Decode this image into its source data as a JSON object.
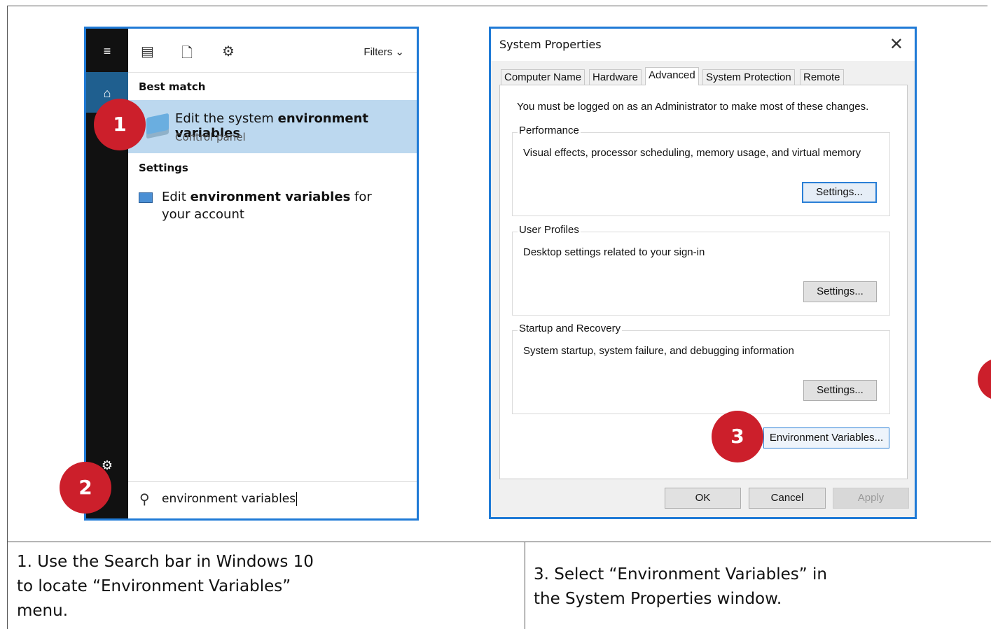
{
  "start_menu": {
    "filters_label": "Filters",
    "best_match_label": "Best match",
    "best_match": {
      "title_prefix": "Edit the system ",
      "title_bold": "environment variables",
      "subtitle": "Control panel"
    },
    "settings_label": "Settings",
    "settings_item": {
      "prefix": "Edit ",
      "bold": "environment variables",
      "suffix": " for your account"
    },
    "search_query": "environment variables"
  },
  "badges": {
    "one": "1",
    "two": "2",
    "three": "3"
  },
  "dialog": {
    "title": "System Properties",
    "tabs": [
      "Computer Name",
      "Hardware",
      "Advanced",
      "System Protection",
      "Remote"
    ],
    "active_tab": "Advanced",
    "note": "You must be logged on as an Administrator to make most of these changes.",
    "groups": [
      {
        "label": "Performance",
        "desc": "Visual effects, processor scheduling, memory usage, and virtual memory",
        "button": "Settings..."
      },
      {
        "label": "User Profiles",
        "desc": "Desktop settings related to your sign-in",
        "button": "Settings..."
      },
      {
        "label": "Startup and Recovery",
        "desc": "System startup, system failure, and debugging information",
        "button": "Settings..."
      }
    ],
    "env_button": "Environment Variables...",
    "ok": "OK",
    "cancel": "Cancel",
    "apply": "Apply"
  },
  "captions": {
    "left": "1. Use the Search bar in Windows 10 to locate “Environment Variables” menu.",
    "right": "3. Select “Environment Variables” in the System Properties window."
  },
  "colors": {
    "accent_border": "#1f7ad6",
    "badge": "#cc1f2b",
    "selection": "#bcd8ef"
  }
}
